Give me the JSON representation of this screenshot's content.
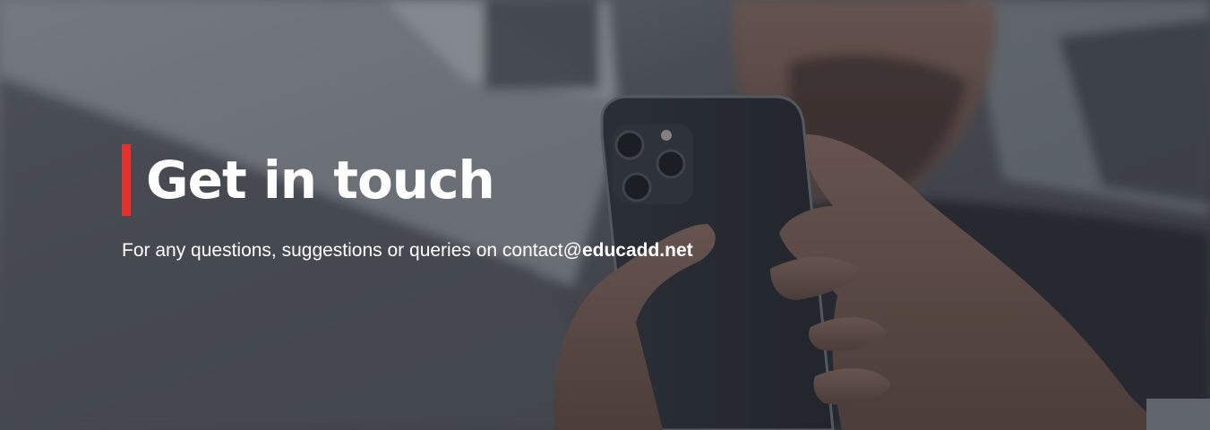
{
  "hero": {
    "title": "Get in touch",
    "subtitle_prefix": "For any questions, suggestions or queries on contact@",
    "subtitle_domain": "educadd.net",
    "background_image": "person-holding-smartphone-photo",
    "colors": {
      "accent": "#e5302c",
      "overlay": "#3d4148",
      "text": "#ffffff"
    }
  }
}
